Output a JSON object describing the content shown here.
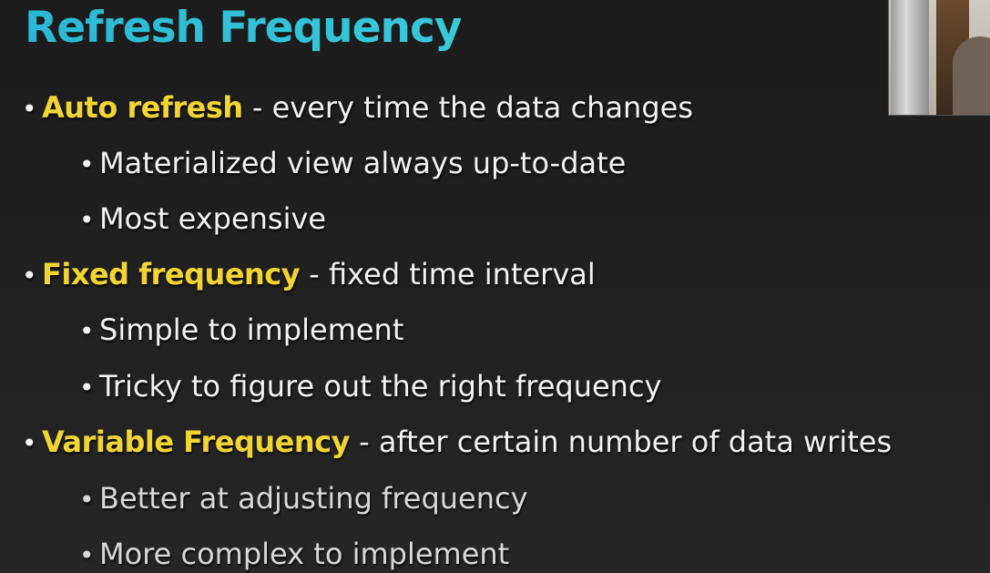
{
  "slide": {
    "title": "Refresh Frequency",
    "bullet_glyph": "•",
    "items": [
      {
        "term": "Auto refresh",
        "description": " - every time the data changes",
        "subitems": [
          "Materialized view always up-to-date",
          "Most expensive"
        ]
      },
      {
        "term": "Fixed frequency",
        "description": " - fixed time interval",
        "subitems": [
          "Simple to implement",
          "Tricky to figure out the right frequency"
        ]
      },
      {
        "term": "Variable Frequency",
        "description": " - after certain number of data writes",
        "subitems": [
          "Better at adjusting frequency",
          "More complex to implement"
        ]
      }
    ]
  },
  "colors": {
    "title": "#2bb8d6",
    "term": "#f2d533",
    "text": "#f2f2f2",
    "background": "#1e1e1e"
  }
}
